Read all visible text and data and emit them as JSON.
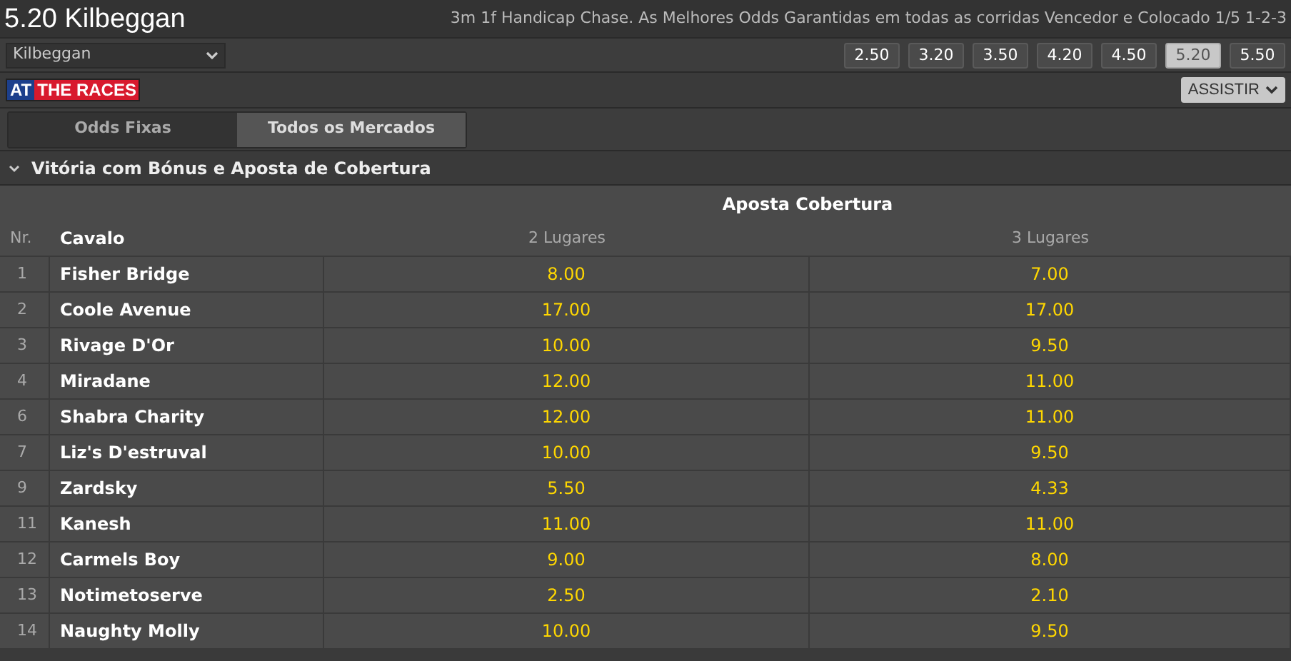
{
  "header": {
    "title": "5.20 Kilbeggan",
    "description": "3m 1f Handicap Chase. As Melhores Odds Garantidas em todas as corridas Vencedor e Colocado 1/5 1-2-3"
  },
  "venue_select": {
    "value": "Kilbeggan"
  },
  "race_times": [
    {
      "label": "2.50",
      "selected": false
    },
    {
      "label": "3.20",
      "selected": false
    },
    {
      "label": "3.50",
      "selected": false
    },
    {
      "label": "4.20",
      "selected": false
    },
    {
      "label": "4.50",
      "selected": false
    },
    {
      "label": "5.20",
      "selected": true
    },
    {
      "label": "5.50",
      "selected": false
    }
  ],
  "logo": {
    "left": "AT",
    "right": "THE RACES"
  },
  "watch_button": {
    "label": "ASSISTIR"
  },
  "tabs": [
    {
      "label": "Odds Fixas",
      "selected": false
    },
    {
      "label": "Todos os Mercados",
      "selected": true
    }
  ],
  "section": {
    "title": "Vitória com Bónus e Aposta de Cobertura",
    "expanded": true
  },
  "table": {
    "group_heading": "Aposta Cobertura",
    "columns": [
      "Nr.",
      "Cavalo",
      "2 Lugares",
      "3 Lugares"
    ],
    "rows": [
      {
        "nr": "1",
        "horse": "Fisher Bridge",
        "odds": [
          "8.00",
          "7.00"
        ]
      },
      {
        "nr": "2",
        "horse": "Coole Avenue",
        "odds": [
          "17.00",
          "17.00"
        ]
      },
      {
        "nr": "3",
        "horse": "Rivage D'Or",
        "odds": [
          "10.00",
          "9.50"
        ]
      },
      {
        "nr": "4",
        "horse": "Miradane",
        "odds": [
          "12.00",
          "11.00"
        ]
      },
      {
        "nr": "6",
        "horse": "Shabra Charity",
        "odds": [
          "12.00",
          "11.00"
        ]
      },
      {
        "nr": "7",
        "horse": "Liz's D'estruval",
        "odds": [
          "10.00",
          "9.50"
        ]
      },
      {
        "nr": "9",
        "horse": "Zardsky",
        "odds": [
          "5.50",
          "4.33"
        ]
      },
      {
        "nr": "11",
        "horse": "Kanesh",
        "odds": [
          "11.00",
          "11.00"
        ]
      },
      {
        "nr": "12",
        "horse": "Carmels Boy",
        "odds": [
          "9.00",
          "8.00"
        ]
      },
      {
        "nr": "13",
        "horse": "Notimetoserve",
        "odds": [
          "2.50",
          "2.10"
        ]
      },
      {
        "nr": "14",
        "horse": "Naughty Molly",
        "odds": [
          "10.00",
          "9.50"
        ]
      }
    ]
  }
}
